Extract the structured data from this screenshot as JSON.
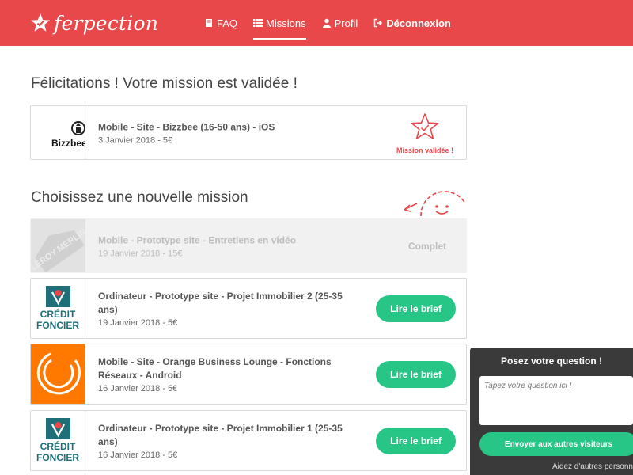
{
  "brand": {
    "name": "ferpection"
  },
  "nav": {
    "faq": "FAQ",
    "missions": "Missions",
    "profile": "Profil",
    "logout": "Déconnexion"
  },
  "validated_section": {
    "heading": "Félicitations ! Votre mission est validée !",
    "mission": {
      "logo_text": "Bizzbee",
      "title": "Mobile - Site - Bizzbee (16-50 ans) - iOS",
      "subtitle": "3 Janvier 2018 - 5€",
      "status": "Mission validée !"
    }
  },
  "new_section": {
    "heading": "Choisissez une nouvelle mission",
    "missions": [
      {
        "logo": "LEROY MERLIN",
        "title": "Mobile - Prototype site - Entretiens en vidéo",
        "subtitle": "19 Janvier 2018 - 15€",
        "status": "Complet"
      },
      {
        "logo_line1": "CRÉDIT",
        "logo_line2": "FONCIER",
        "title": "Ordinateur - Prototype site - Projet Immobilier 2 (25-35 ans)",
        "subtitle": "19 Janvier 2018 - 5€",
        "button": "Lire le brief"
      },
      {
        "title": "Mobile - Site - Orange Business Lounge - Fonctions Réseaux - Android",
        "subtitle": "16 Janvier 2018 - 5€",
        "button": "Lire le brief"
      },
      {
        "logo_line1": "CRÉDIT",
        "logo_line2": "FONCIER",
        "title": "Ordinateur - Prototype site - Projet Immobilier 1 (25-35 ans)",
        "subtitle": "16 Janvier 2018 - 5€",
        "button": "Lire le brief"
      }
    ]
  },
  "question_widget": {
    "title": "Posez votre question !",
    "placeholder": "Tapez votre question ici !",
    "send_button": "Envoyer aux autres visiteurs",
    "help_text": "Aidez d'autres personn"
  },
  "colors": {
    "brand_red": "#e9484b",
    "green": "#27c686",
    "widget_dark": "#3a3a3a",
    "orange": "#ff7900",
    "credit_foncier_teal": "#1f6f78"
  }
}
